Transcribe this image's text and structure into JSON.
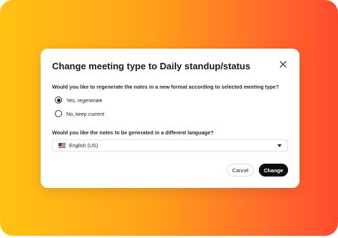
{
  "dialog": {
    "title": "Change meeting type to Daily standup/status",
    "close_icon": "close-icon"
  },
  "regenerate": {
    "question": "Would you like to regenerate the notes in a new format according to selected meeting type?",
    "options": [
      {
        "label": "Yes, regenerate",
        "selected": true
      },
      {
        "label": "No, keep current",
        "selected": false
      }
    ]
  },
  "language": {
    "question": "Would you like the notes to be generated in a different language?",
    "selected": "English (US)",
    "flag_icon": "us-flag-icon",
    "dropdown_icon": "caret-down-icon"
  },
  "actions": {
    "cancel_label": "Cancel",
    "change_label": "Change"
  },
  "colors": {
    "gradient_start": "#ffc313",
    "gradient_end": "#ff4b2d",
    "primary_button": "#0d0d0d"
  }
}
